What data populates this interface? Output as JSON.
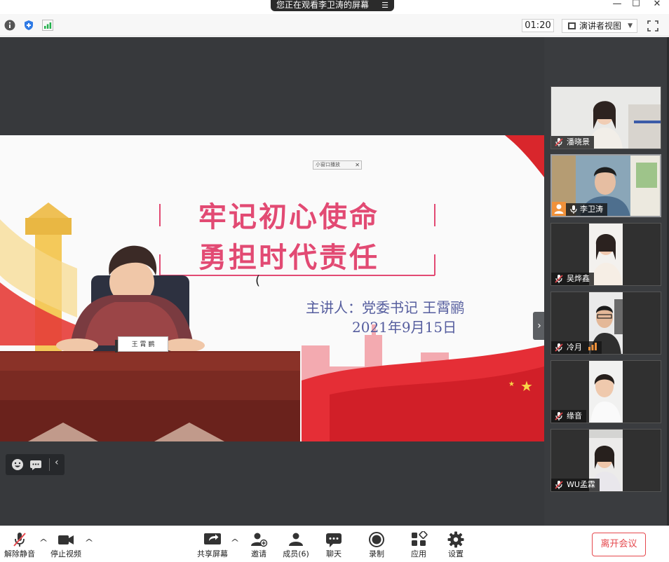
{
  "window": {
    "share_notice": "您正在观看李卫涛的屏幕",
    "minimize": "—",
    "maximize": "☐",
    "close": "✕"
  },
  "toolbar": {
    "timer": "01:20",
    "view_label": "演讲者视图",
    "view_caret": "▼"
  },
  "slide": {
    "mini_window_badge": "小窗口播放",
    "title_line1": "牢记初心使命",
    "title_line2": "勇担时代责任",
    "speaker_line": "主讲人：党委书记  王霄鹂",
    "date_line": "2021年9月15日",
    "nameplate": "王 霄 鹂"
  },
  "gallery": {
    "expand_handle": "›",
    "participants": [
      {
        "name": "潘晓景",
        "muted": true
      },
      {
        "name": "李卫涛",
        "muted": false,
        "host": true
      },
      {
        "name": "吴烨鑫",
        "muted": true
      },
      {
        "name": "冷月",
        "muted": true,
        "speaking": true
      },
      {
        "name": "缘音",
        "muted": true
      },
      {
        "name": "WU孟霖",
        "muted": true
      }
    ]
  },
  "bottombar": {
    "unmute": "解除静音",
    "stop_video": "停止视频",
    "share_screen": "共享屏幕",
    "invite": "邀请",
    "participants": "成员(6)",
    "chat": "聊天",
    "record": "录制",
    "apps": "应用",
    "settings": "设置",
    "leave": "离开会议"
  },
  "colors": {
    "accent_red": "#e5484d",
    "slide_title_pink": "#e24a73",
    "slide_subtitle_blue": "#555d9e",
    "host_orange": "#f0913a",
    "signal_green": "#22b14c"
  }
}
